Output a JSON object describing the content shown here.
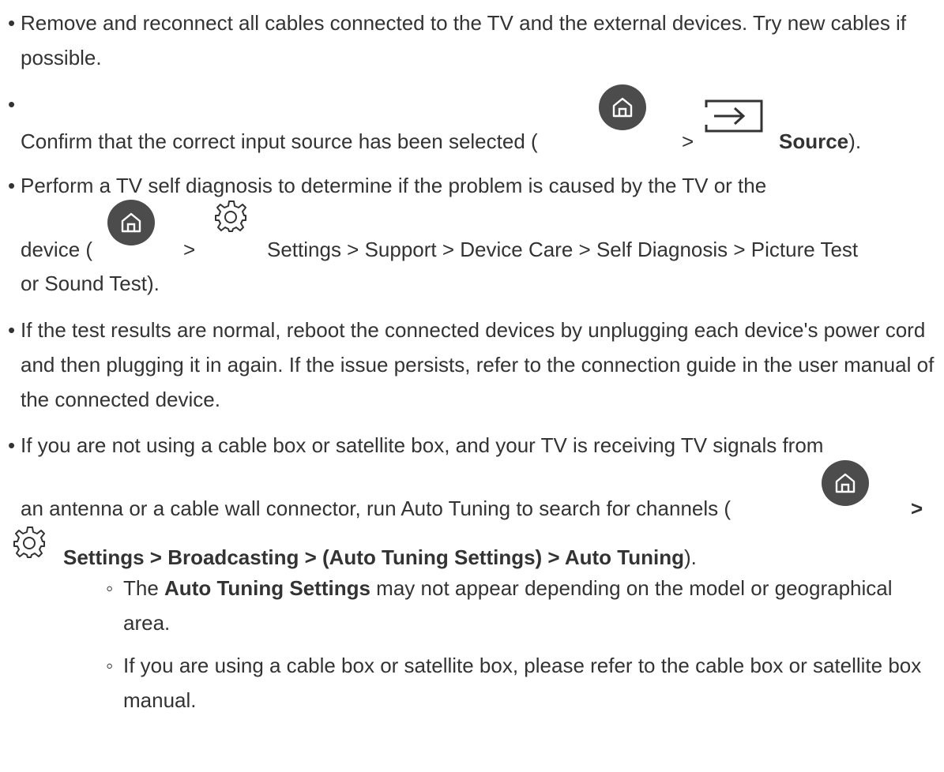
{
  "bullets": {
    "main": "•",
    "sub": "◦",
    "separator": ">",
    "open_paren": "(",
    "close_paren": ")."
  },
  "item1": {
    "text": "Remove and reconnect all cables connected to the TV and the external devices. Try new cables if possible."
  },
  "item2": {
    "text_before": "Confirm that the correct input source has been selected (",
    "source_label": "Source",
    "close": ")."
  },
  "item3": {
    "line1": "Perform a TV self diagnosis to determine if the problem is caused by the TV or the",
    "line2_before": "device (",
    "line2_after": "Settings > Support > Device Care > Self Diagnosis > Picture Test",
    "line3": "or Sound Test)."
  },
  "item4": {
    "text": "If the test results are normal, reboot the connected devices by unplugging each device's power cord and then plugging it in again. If the issue persists, refer to the connection guide in the user manual of the connected device."
  },
  "item5": {
    "line1": "If you are not using a cable box or satellite box, and your TV is receiving TV signals from",
    "line2_before": "an antenna or a cable wall connector, run Auto Tuning to search for channels (",
    "line2_sep": ">",
    "line3_bold": "Settings > Broadcasting > (Auto Tuning Settings) > Auto Tuning",
    "line3_close": ")."
  },
  "subitems": [
    {
      "before": "The ",
      "bold": "Auto Tuning Settings",
      "after": " may not appear depending on the model or geographical area."
    },
    {
      "text": "If you are using a cable box or satellite box, please refer to the cable box or satellite box manual."
    }
  ],
  "icons": {
    "home": "home-icon",
    "source": "source-input-icon",
    "settings": "settings-gear-icon"
  },
  "colors": {
    "text": "#333333",
    "icon_circle": "#4c4c4c",
    "icon_line": "#ffffff"
  }
}
